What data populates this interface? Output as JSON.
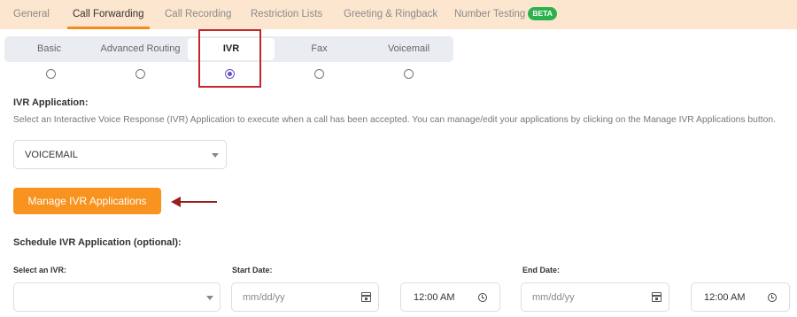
{
  "top_tabs": [
    {
      "label": "General"
    },
    {
      "label": "Call Forwarding"
    },
    {
      "label": "Call Recording"
    },
    {
      "label": "Restriction Lists"
    },
    {
      "label": "Greeting & Ringback"
    },
    {
      "label": "Number Testing"
    }
  ],
  "active_top_tab": "Call Forwarding",
  "beta_badge": "BETA",
  "routing_options": [
    {
      "label": "Basic",
      "selected": false
    },
    {
      "label": "Advanced Routing",
      "selected": false
    },
    {
      "label": "IVR",
      "selected": true
    },
    {
      "label": "Fax",
      "selected": false
    },
    {
      "label": "Voicemail",
      "selected": false
    }
  ],
  "ivr": {
    "heading": "IVR Application:",
    "description": "Select an Interactive Voice Response (IVR) Application to execute when a call has been accepted. You can manage/edit your applications by clicking on the Manage IVR Applications button.",
    "selected_value": "VOICEMAIL",
    "manage_button": "Manage IVR Applications"
  },
  "schedule": {
    "heading": "Schedule IVR Application (optional):",
    "select_label": "Select an IVR:",
    "start_label": "Start Date:",
    "end_label": "End Date:",
    "start_date_placeholder": "mm/dd/yy",
    "start_time": "12:00 AM",
    "end_date_placeholder": "mm/dd/yy",
    "end_time": "12:00 AM"
  },
  "colors": {
    "accent": "#f7931e",
    "tabbar_bg": "#fde6cf",
    "radio_checked": "#6c4ec2",
    "beta_badge": "#2bb24c",
    "highlight_box": "#c0282d",
    "annotation_arrow": "#9a1c1f"
  },
  "icons": [
    "calendar-icon",
    "clock-icon",
    "chevron-down-icon",
    "radio-button",
    "annotation-arrow"
  ]
}
